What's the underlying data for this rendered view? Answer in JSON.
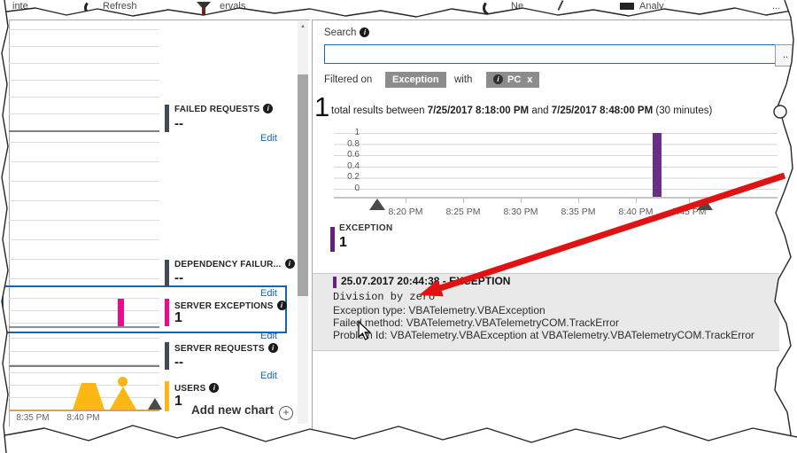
{
  "tear_fragments": {
    "frag_inte": "inte",
    "frag_refresh": "Refresh",
    "frag_intervals": "ervals",
    "frag_ne": "Ne",
    "frag_analy": "Analy",
    "frag_dots": "..."
  },
  "left_panel": {
    "edit_label": "Edit",
    "add_new_chart_label": "Add new chart",
    "x_labels": [
      "8:35 PM",
      "8:40 PM"
    ],
    "charts": [
      {
        "label": "FAILED REQUESTS",
        "value": "--"
      },
      {
        "label": "DEPENDENCY FAILUR...",
        "value": "--"
      },
      {
        "label": "SERVER EXCEPTIONS",
        "value": "1"
      },
      {
        "label": "SERVER REQUESTS",
        "value": "--"
      },
      {
        "label": "USERS",
        "value": "1"
      }
    ]
  },
  "search": {
    "label": "Search",
    "value": "",
    "more_button": ".."
  },
  "filter": {
    "prefix": "Filtered on",
    "type_badge": "Exception",
    "connector": "with",
    "chip_label": "PC",
    "chip_close": "x"
  },
  "results": {
    "count": "1",
    "pre": "total results between",
    "start": "7/25/2017 8:18:00 PM",
    "conj": "and",
    "end": "7/25/2017 8:48:00 PM",
    "suffix": "(30 minutes)"
  },
  "timeline": {
    "y_ticks": [
      "1",
      "0.8",
      "0.6",
      "0.4",
      "0.2",
      "0"
    ],
    "x_ticks": [
      "8:20 PM",
      "8:25 PM",
      "8:30 PM",
      "8:35 PM",
      "8:40 PM",
      "8:45 PM"
    ]
  },
  "legend": {
    "label": "EXCEPTION",
    "value": "1"
  },
  "detail": {
    "title": "25.07.2017 20:44:38 - EXCEPTION",
    "message": "Division by zero",
    "exception_type": "Exception type: VBATelemetry.VBAException",
    "failed_method": "Failed method: VBATelemetry.VBATelemetryCOM.TrackError",
    "problem_id": "Problem Id: VBATelemetry.VBAException at VBATelemetry.VBATelemetryCOM.TrackError"
  },
  "colors": {
    "accent_purple": "#68217a",
    "accent_pink": "#ec0b8a",
    "accent_orange": "#fcb714",
    "slate_chip": "#424b53",
    "link_blue": "#1263b8",
    "selection_blue": "#1466ad",
    "badge_gray": "#8c8c8c",
    "annotation_red": "#e01313"
  },
  "chart_data": [
    {
      "type": "bar",
      "name": "search-results-timeline",
      "title": "1 total results between 7/25/2017 8:18:00 PM and 7/25/2017 8:48:00 PM (30 minutes)",
      "series": [
        {
          "name": "EXCEPTION",
          "color": "#68217a",
          "points": [
            {
              "x": "8:44 PM",
              "y": 1
            }
          ]
        }
      ],
      "x_ticks": [
        "8:20 PM",
        "8:25 PM",
        "8:30 PM",
        "8:35 PM",
        "8:40 PM",
        "8:45 PM"
      ],
      "y_ticks": [
        1,
        0.8,
        0.6,
        0.4,
        0.2,
        0
      ],
      "ylim": [
        0,
        1
      ],
      "grid": true,
      "legend_position": "bottom-left",
      "range_selection": [
        "8:18 PM",
        "8:48 PM"
      ]
    },
    {
      "type": "bar",
      "name": "server-exceptions-sparkline",
      "label": "SERVER EXCEPTIONS",
      "total": 1,
      "color": "#ec0b8a",
      "points": [
        {
          "x": "~8:44 PM",
          "y": 1
        }
      ]
    },
    {
      "type": "area",
      "name": "users-sparkline",
      "label": "USERS",
      "total": 1,
      "color": "#fcb714",
      "x_ticks": [
        "8:35 PM",
        "8:40 PM"
      ],
      "peaks": [
        {
          "x": "8:38 PM",
          "y": 1
        },
        {
          "x": "8:41 PM",
          "y": 1
        }
      ]
    },
    {
      "type": "bar",
      "name": "failed-requests-sparkline",
      "label": "FAILED REQUESTS",
      "total": "--",
      "points": []
    },
    {
      "type": "bar",
      "name": "dependency-failures-sparkline",
      "label": "DEPENDENCY FAILUR...",
      "total": "--",
      "points": []
    },
    {
      "type": "bar",
      "name": "server-requests-sparkline",
      "label": "SERVER REQUESTS",
      "total": "--",
      "points": []
    }
  ]
}
